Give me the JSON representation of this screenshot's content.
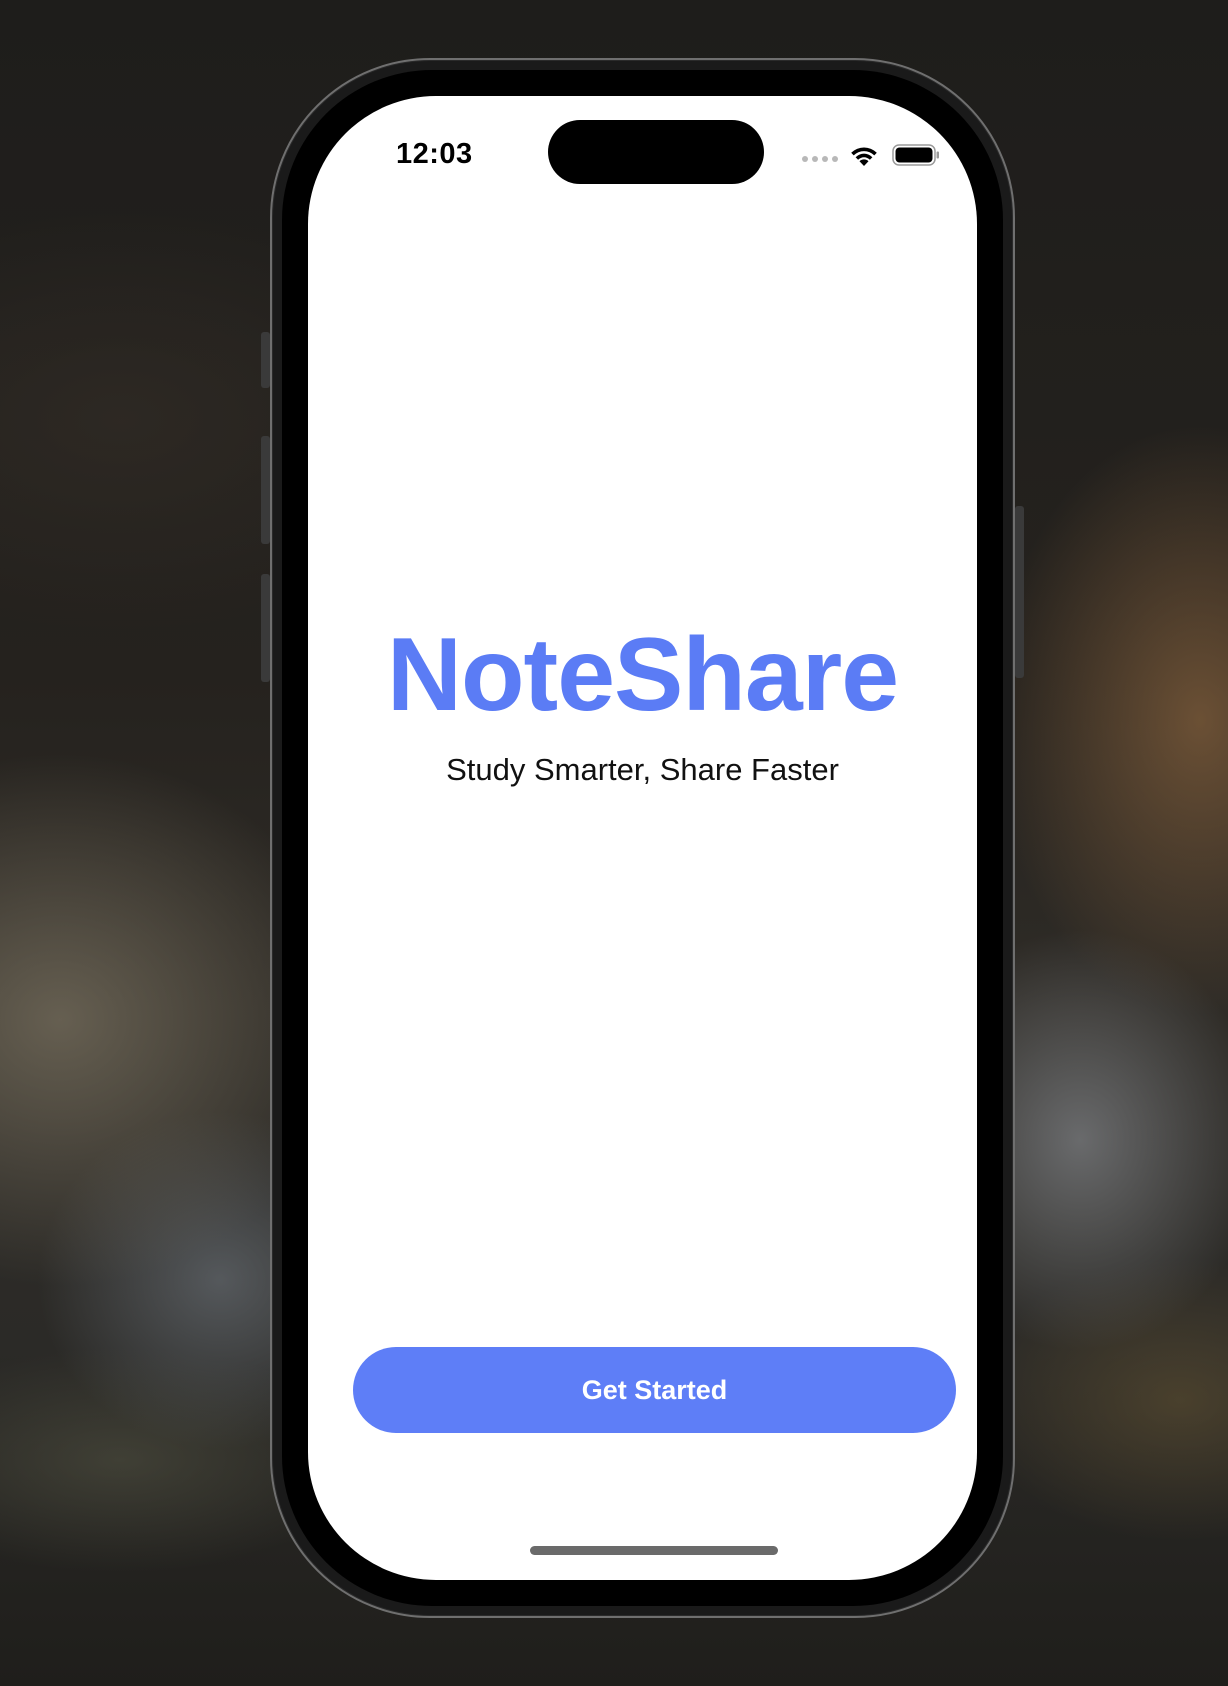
{
  "status_bar": {
    "time": "12:03",
    "icons": [
      "cellular-signal-icon",
      "wifi-icon",
      "battery-icon"
    ]
  },
  "app": {
    "title": "NoteShare",
    "tagline": "Study Smarter, Share Faster",
    "cta_label": "Get Started"
  },
  "colors": {
    "brand": "#5b7cf5",
    "button": "#5e7ef7",
    "button_text": "#ffffff",
    "screen_background": "#ffffff"
  }
}
